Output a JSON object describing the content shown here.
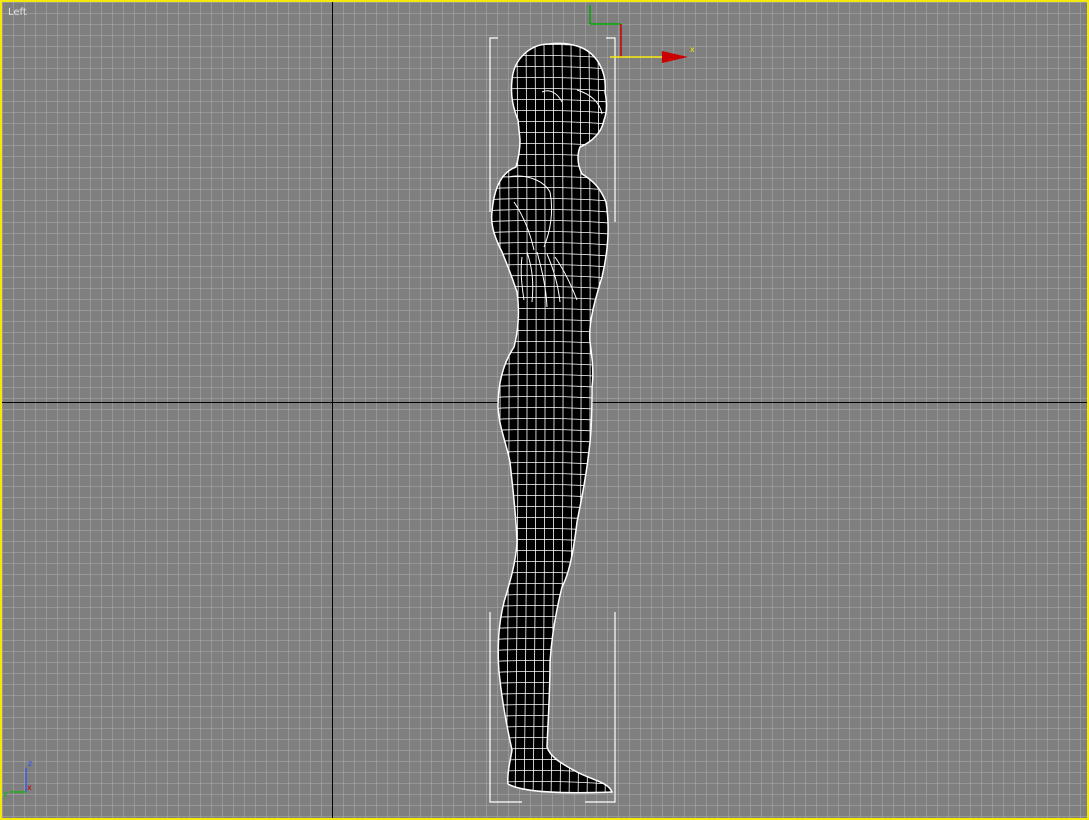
{
  "viewport": {
    "label": "Left",
    "border_color": "#f5e90a",
    "background_color": "#7f7f7f",
    "grid_color": "#a9a9a9"
  },
  "gizmo": {
    "x_label": "x",
    "x_color": "#cc0000",
    "y_color": "#00aa00",
    "plane_color": "#f5e90a"
  },
  "view_axes": {
    "z_label": "z",
    "y_label": "y",
    "x_label": "x",
    "z_color": "#3050ff",
    "y_color": "#00bb00",
    "x_color": "#cc0000"
  },
  "model": {
    "wire_color": "#ffffff",
    "fill_color": "#000000",
    "bracket_color": "#ffffff"
  }
}
